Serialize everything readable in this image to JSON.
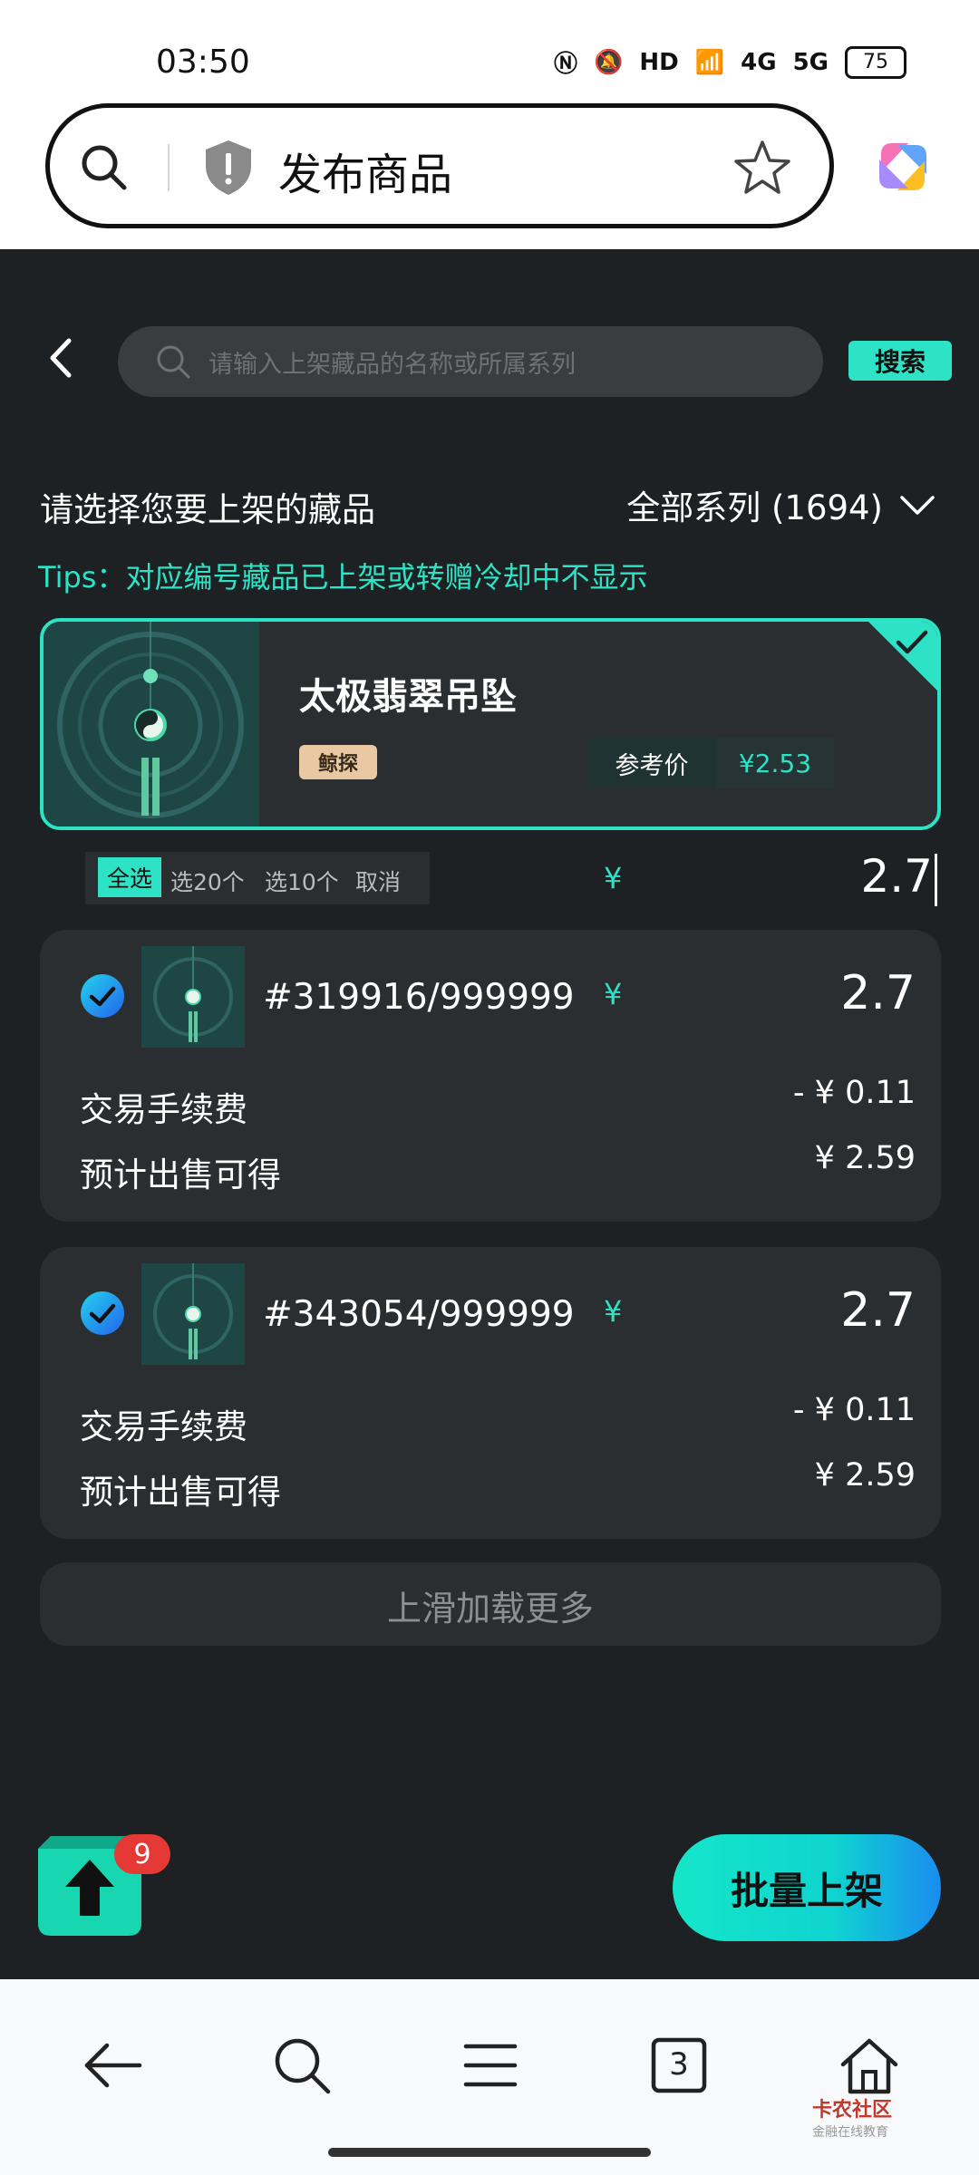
{
  "status_bar": {
    "time": "03:50",
    "battery": "75",
    "net1": "HD",
    "net2": "4G",
    "net3": "5G"
  },
  "browser": {
    "url_title": "发布商品"
  },
  "header": {
    "search_placeholder": "请输入上架藏品的名称或所属系列",
    "search_button": "搜索"
  },
  "filter": {
    "title": "请选择您要上架的藏品",
    "series_label": "全部系列 (1694)",
    "tips": "Tips：对应编号藏品已上架或转赠冷却中不显示"
  },
  "product": {
    "name": "太极翡翠吊坠",
    "brand": "鲸探",
    "ref_price_label": "参考价",
    "ref_price_value": "¥2.53"
  },
  "selection": {
    "select_all": "全选",
    "select20": "选20个",
    "select10": "选10个",
    "cancel": "取消",
    "yen": "¥",
    "price": "2.7"
  },
  "items": [
    {
      "number": "#319916/999999",
      "yen": "¥",
      "price": "2.7",
      "fee_label": "交易手续费",
      "fee_value": "- ¥ 0.11",
      "net_label": "预计出售可得",
      "net_value": "¥ 2.59"
    },
    {
      "number": "#343054/999999",
      "yen": "¥",
      "price": "2.7",
      "fee_label": "交易手续费",
      "fee_value": "- ¥ 0.11",
      "net_label": "预计出售可得",
      "net_value": "¥ 2.59"
    }
  ],
  "load_more": "上滑加载更多",
  "fab": {
    "badge_count": "9"
  },
  "batch_button": "批量上架",
  "bottom_nav": {
    "tabs_count": "3"
  },
  "watermark": {
    "name": "卡农社区",
    "sub": "金融在线教育"
  },
  "colors": {
    "accent": "#2de2c5",
    "background": "#1e2123",
    "card": "#2b2e30"
  }
}
